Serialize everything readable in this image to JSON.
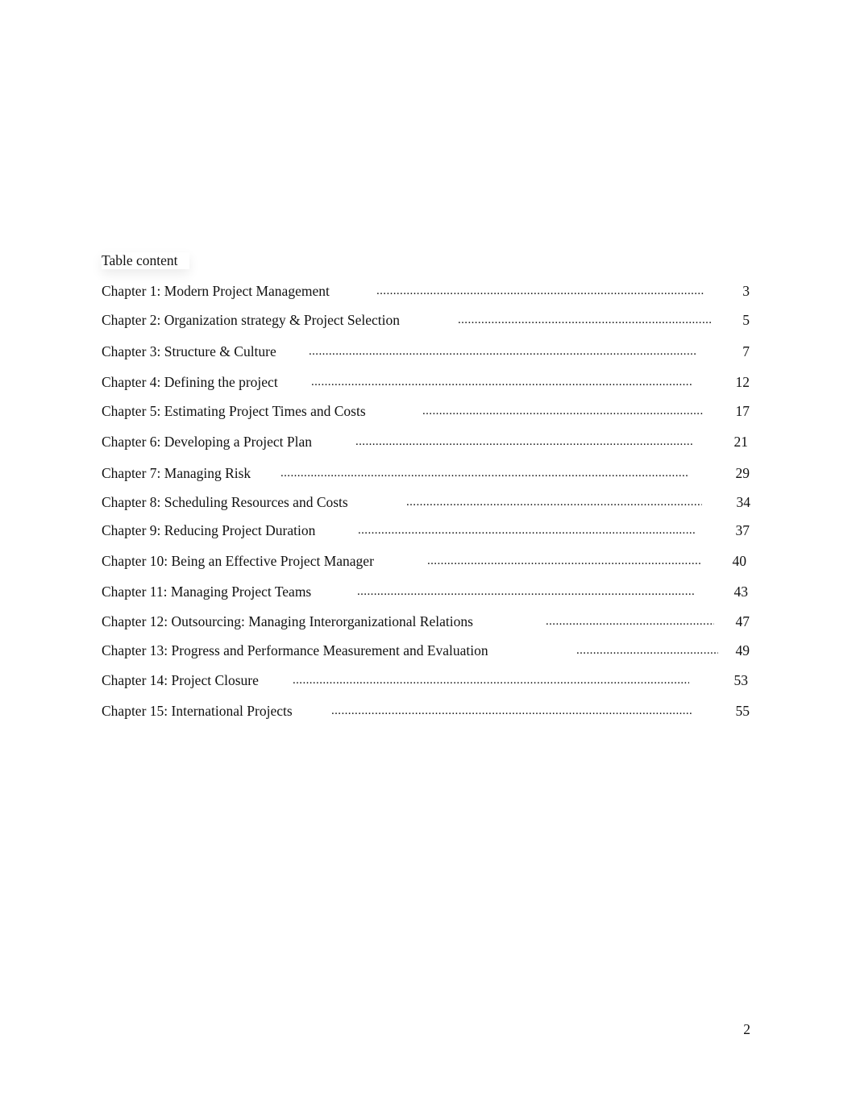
{
  "toc": {
    "title": "Table content",
    "entries": [
      {
        "label": "Chapter 1: Modern Project Management",
        "page": "3"
      },
      {
        "label": "Chapter 2: Organization strategy & Project Selection",
        "page": "5"
      },
      {
        "label": "Chapter 3: Structure & Culture",
        "page": "7"
      },
      {
        "label": "Chapter 4: Defining the project",
        "page": "12"
      },
      {
        "label": "Chapter 5: Estimating Project Times and Costs",
        "page": "17"
      },
      {
        "label": "Chapter 6: Developing a Project Plan",
        "page": "21"
      },
      {
        "label": "Chapter 7: Managing Risk",
        "page": "29"
      },
      {
        "label": "Chapter 8:   Scheduling Resources and Costs",
        "page": "34"
      },
      {
        "label": "Chapter 9: Reducing Project Duration",
        "page": "37"
      },
      {
        "label": "Chapter 10: Being an Effective Project Manager",
        "page": "40"
      },
      {
        "label": "Chapter 11: Managing Project Teams",
        "page": "43"
      },
      {
        "label": "Chapter 12: Outsourcing: Managing Interorganizational Relations",
        "page": "47"
      },
      {
        "label": "Chapter 13: Progress and Performance Measurement and Evaluation",
        "page": "49"
      },
      {
        "label": "Chapter 14: Project Closure",
        "page": "53"
      },
      {
        "label": "Chapter 15: International Projects",
        "page": "55"
      }
    ]
  },
  "footer": {
    "page_number": "2"
  }
}
